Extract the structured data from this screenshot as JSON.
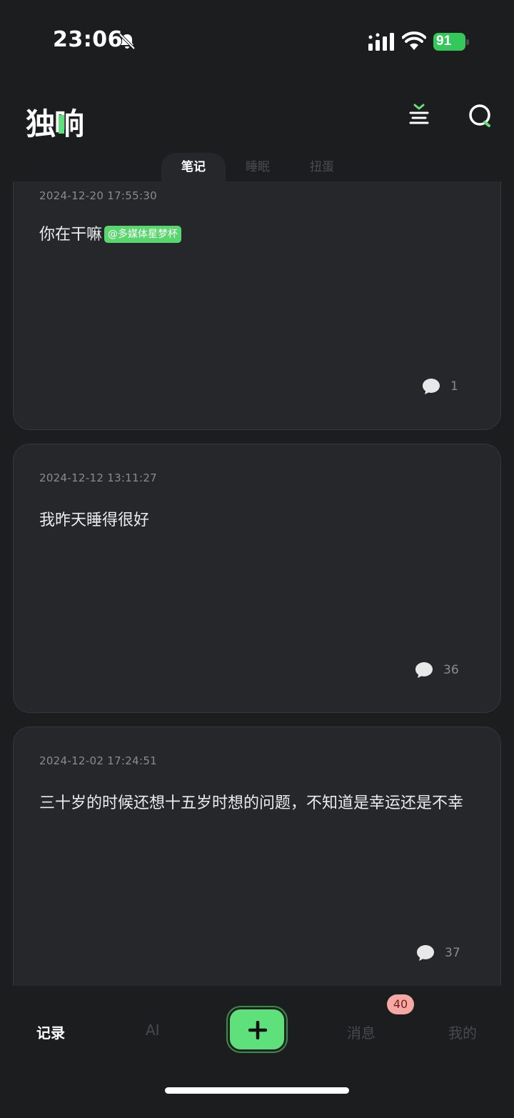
{
  "status": {
    "time": "23:06",
    "battery": "91"
  },
  "header": {
    "logo_first": "独",
    "logo_second": "响"
  },
  "tabs": [
    {
      "label": "笔记",
      "active": true
    },
    {
      "label": "睡眠",
      "active": false
    },
    {
      "label": "扭蛋",
      "active": false
    }
  ],
  "posts": [
    {
      "date": "2024-12-20 17:55:30",
      "text": "你在干嘛",
      "mention": "@多媒体星梦杯",
      "comments": "1"
    },
    {
      "date": "2024-12-12 13:11:27",
      "text": "我昨天睡得很好",
      "comments": "36"
    },
    {
      "date": "2024-12-02 17:24:51",
      "text": "三十岁的时候还想十五岁时想的问题，不知道是幸运还是不幸",
      "comments": "37"
    }
  ],
  "nav": {
    "records": "记录",
    "ai": "AI",
    "messages": "消息",
    "mine": "我的",
    "message_badge": "40"
  },
  "colors": {
    "accent": "#5ee07a",
    "background": "#1c1d1f",
    "card": "#26272b",
    "badge": "#f4a9a5"
  }
}
